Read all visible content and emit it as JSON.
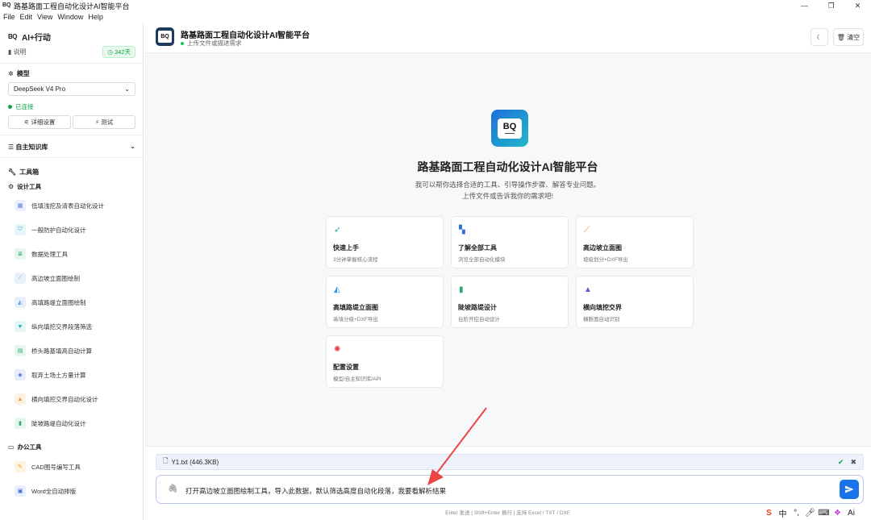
{
  "window": {
    "title": "路基路面工程自动化设计AI智能平台",
    "menu": [
      "File",
      "Edit",
      "View",
      "Window",
      "Help"
    ]
  },
  "sidebar": {
    "brand": "AI+行动",
    "info_label": "说明",
    "days_badge": "342天",
    "model_section": "模型",
    "model_selected": "DeepSeek V4 Pro",
    "connected": "已连接",
    "detail_settings": "详细设置",
    "test": "测试",
    "knowledge_base": "自主知识库",
    "toolbox": "工具箱",
    "design_tools": "设计工具",
    "tools": [
      {
        "label": "低填浅挖及清表自动化设计",
        "icon": "table-icon",
        "color": "#5b7fd6",
        "bg": "#eaf0fc"
      },
      {
        "label": "一般防护自动化设计",
        "icon": "shield-icon",
        "color": "#3aa3c4",
        "bg": "#e6f5fa"
      },
      {
        "label": "数据处理工具",
        "icon": "database-icon",
        "color": "#2fa86b",
        "bg": "#e5f6ed"
      },
      {
        "label": "高边坡立面图绘制",
        "icon": "chart-line-icon",
        "color": "#4a8fd6",
        "bg": "#e8f1fb"
      },
      {
        "label": "高填路堤立面图绘制",
        "icon": "area-chart-icon",
        "color": "#4a8fd6",
        "bg": "#e8f1fb"
      },
      {
        "label": "纵向填挖交界段落筛选",
        "icon": "filter-icon",
        "color": "#2aa6a6",
        "bg": "#e4f6f6"
      },
      {
        "label": "桥头路基填高自动计算",
        "icon": "calculator-icon",
        "color": "#2fa86b",
        "bg": "#e5f6ed"
      },
      {
        "label": "取弃土场土方量计算",
        "icon": "cube-icon",
        "color": "#3b5bd6",
        "bg": "#e8ecfb"
      },
      {
        "label": "横向填挖交界自动化设计",
        "icon": "mountain-icon",
        "color": "#e89420",
        "bg": "#fdf2e2"
      },
      {
        "label": "陡坡路堤自动化设计",
        "icon": "signal-icon",
        "color": "#2fa86b",
        "bg": "#e5f6ed"
      }
    ],
    "office_tools": "办公工具",
    "office": [
      {
        "label": "CAD图号编写工具",
        "icon": "pen-icon",
        "color": "#e8a020",
        "bg": "#fdf3e0"
      },
      {
        "label": "Word全自动排版",
        "icon": "word-icon",
        "color": "#3b6fd6",
        "bg": "#e8effb"
      }
    ]
  },
  "header": {
    "title": "路基路面工程自动化设计AI智能平台",
    "subtitle": "上传文件或描述需求",
    "clear_label": "清空",
    "logo_text": "BQ"
  },
  "welcome": {
    "logo_text": "BQ",
    "title": "路基路面工程自动化设计AI智能平台",
    "line1": "我可以帮你选择合适的工具、引导操作步骤、解答专业问题。",
    "line2": "上传文件或告诉我你的需求吧!"
  },
  "cards": [
    {
      "title": "快速上手",
      "sub": "3分钟掌握核心流程",
      "icon": "rocket-icon",
      "color": "#1aa39a"
    },
    {
      "title": "了解全部工具",
      "sub": "浏览全部自动化模块",
      "icon": "grid-icon",
      "color": "#2f6fe0"
    },
    {
      "title": "高边坡立面图",
      "sub": "坡级划分+DXF导出",
      "icon": "chart-line-icon",
      "color": "#e08a20"
    },
    {
      "title": "高填路堤立面图",
      "sub": "高填分级+DXF导出",
      "icon": "area-chart-icon",
      "color": "#2a8fe0"
    },
    {
      "title": "陡坡路堤设计",
      "sub": "台阶开挖自动设计",
      "icon": "signal-icon",
      "color": "#2fa86b"
    },
    {
      "title": "横向填挖交界",
      "sub": "横断面自动识别",
      "icon": "mountain-icon",
      "color": "#7c4ddb"
    },
    {
      "title": "配置设置",
      "sub": "模型/自主知识库/API",
      "icon": "gear-icon",
      "color": "#e03a3a"
    }
  ],
  "upload": {
    "file_name": "Y1.txt (446.3KB)"
  },
  "input": {
    "value": "打开高边坡立面图绘制工具，导入此数据，默认筛选高度自动化段落，我要看解析结果"
  },
  "hint": "Enter 发送 | Shift+Enter 换行 | 支持 Excel / TXT / DXF",
  "tray": {
    "ime_label": "中",
    "extra": "Ai"
  }
}
